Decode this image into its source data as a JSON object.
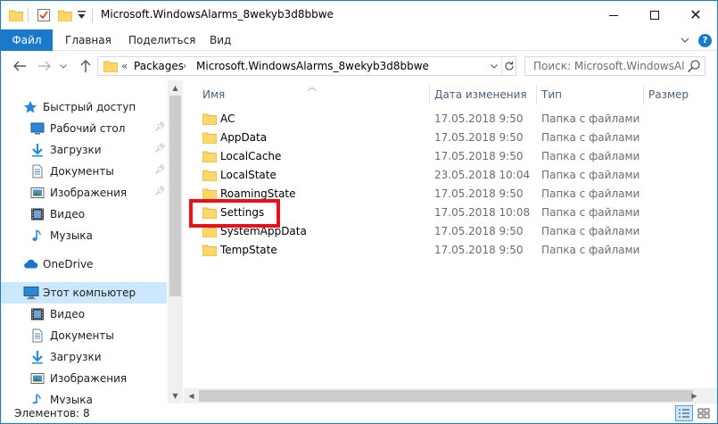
{
  "window": {
    "title": "Microsoft.WindowsAlarms_8wekyb3d8bbwe"
  },
  "ribbon": {
    "file_tab": "Файл",
    "tabs": [
      "Главная",
      "Поделиться",
      "Вид"
    ]
  },
  "address": {
    "overflow": "«",
    "crumbs": [
      "Packages",
      "Microsoft.WindowsAlarms_8wekyb3d8bbwe"
    ],
    "separator": "›"
  },
  "search": {
    "placeholder": "Поиск: Microsoft.WindowsAl..."
  },
  "nav": {
    "quick_access": "Быстрый доступ",
    "quick_items": [
      {
        "label": "Рабочий стол",
        "icon": "desktop-icon"
      },
      {
        "label": "Загрузки",
        "icon": "downloads-icon"
      },
      {
        "label": "Документы",
        "icon": "documents-icon"
      },
      {
        "label": "Изображения",
        "icon": "pictures-icon"
      },
      {
        "label": "Видео",
        "icon": "video-icon"
      },
      {
        "label": "Музыка",
        "icon": "music-icon"
      }
    ],
    "onedrive": "OneDrive",
    "this_pc": "Этот компьютер",
    "pc_items": [
      {
        "label": "Видео",
        "icon": "video-icon"
      },
      {
        "label": "Документы",
        "icon": "documents-icon"
      },
      {
        "label": "Загрузки",
        "icon": "downloads-icon"
      },
      {
        "label": "Изображения",
        "icon": "pictures-icon"
      },
      {
        "label": "Музыка",
        "icon": "music-icon"
      }
    ]
  },
  "columns": {
    "name": "Имя",
    "date": "Дата изменения",
    "type": "Тип",
    "size": "Размер"
  },
  "files": [
    {
      "name": "AC",
      "date": "17.05.2018 9:50",
      "type": "Папка с файлами"
    },
    {
      "name": "AppData",
      "date": "17.05.2018 9:50",
      "type": "Папка с файлами"
    },
    {
      "name": "LocalCache",
      "date": "17.05.2018 9:50",
      "type": "Папка с файлами"
    },
    {
      "name": "LocalState",
      "date": "23.05.2018 10:04",
      "type": "Папка с файлами"
    },
    {
      "name": "RoamingState",
      "date": "17.05.2018 9:50",
      "type": "Папка с файлами"
    },
    {
      "name": "Settings",
      "date": "17.05.2018 10:08",
      "type": "Папка с файлами",
      "highlighted": true
    },
    {
      "name": "SystemAppData",
      "date": "17.05.2018 9:50",
      "type": "Папка с файлами"
    },
    {
      "name": "TempState",
      "date": "17.05.2018 9:50",
      "type": "Папка с файлами"
    }
  ],
  "status": {
    "items_count": "Элементов: 8"
  },
  "colors": {
    "accent": "#1979ca",
    "highlight_frame": "#e8101a",
    "folder": "#ffd767",
    "selection": "#cce8ff"
  }
}
